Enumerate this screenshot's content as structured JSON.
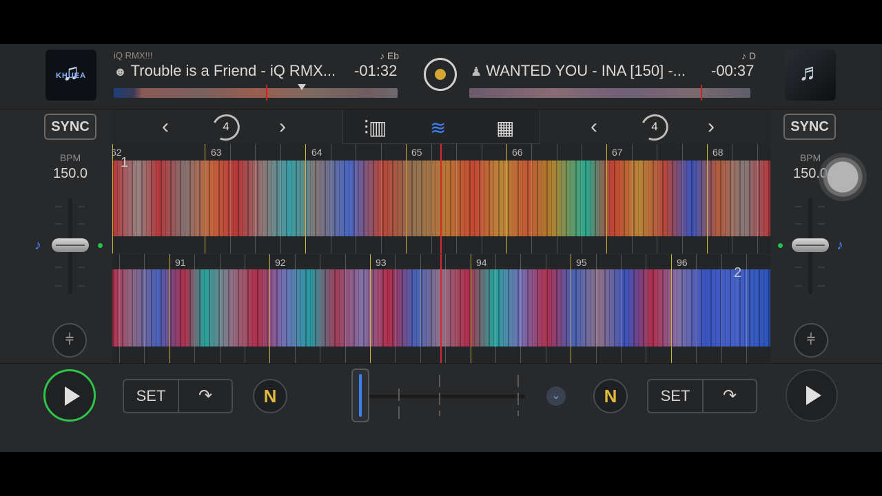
{
  "deckA": {
    "artist_line": "iQ RMX!!!",
    "title": "Trouble is a Friend - iQ RMX...",
    "remaining": "-01:32",
    "key": "Eb",
    "bpm_label": "BPM",
    "bpm": "150.0",
    "sync_label": "SYNC",
    "loop_size": "4",
    "deck_number": "1",
    "bar_numbers": [
      "62",
      "63",
      "64",
      "65",
      "66",
      "67",
      "68"
    ],
    "cover_text": "KHUEA",
    "set_label": "SET",
    "n_label": "N"
  },
  "deckB": {
    "title": "WANTED YOU - INA [150] -...",
    "remaining": "-00:37",
    "key": "D",
    "bpm_label": "BPM",
    "bpm": "150.0",
    "sync_label": "SYNC",
    "loop_size": "4",
    "deck_number": "2",
    "bar_numbers": [
      "91",
      "92",
      "93",
      "94",
      "95",
      "96"
    ],
    "set_label": "SET",
    "n_label": "N"
  },
  "icons": {
    "record": "record-icon",
    "mixer": "mixer-icon",
    "waveform": "waveform-icon",
    "pads": "pads-grid-icon",
    "loop": "loop-icon",
    "eq": "eq-sliders-icon",
    "cue": "cue-jump-icon",
    "play": "play-icon",
    "chevron": "chevron-down-icon"
  },
  "colors": {
    "accent_blue": "#3b82f6",
    "play_active": "#2fc44a",
    "playhead": "#d12a2a",
    "record_dot": "#d6a634"
  }
}
